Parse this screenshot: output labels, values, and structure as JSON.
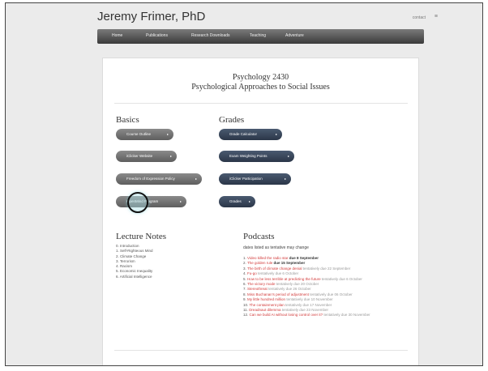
{
  "site": {
    "title": "Jeremy Frimer, PhD",
    "contact": "contact",
    "menu_icon": "hamburger-icon"
  },
  "nav": {
    "items": [
      "Home",
      "Publications",
      "Research Downloads",
      "Teaching",
      "Adventure"
    ]
  },
  "course": {
    "number": "Psychology 2430",
    "name": "Psychological Approaches to Social Issues"
  },
  "basics": {
    "heading": "Basics",
    "buttons": [
      "Course Outline",
      "iClicker Website",
      "Freedom of Expression Policy",
      "OpenMind Program"
    ]
  },
  "grades": {
    "heading": "Grades",
    "buttons": [
      "Grade Calculator",
      "Exam Weighting Points",
      "iClicker Participation",
      "Grades"
    ]
  },
  "lecture_notes": {
    "heading": "Lecture Notes",
    "items": [
      "0. Introduction",
      "1. Self-Righteous Mind",
      "2. Climate Change",
      "3. Terrorism",
      "4. Racism",
      "5. Economic Inequality",
      "6. Artificial Intelligence"
    ]
  },
  "podcasts": {
    "heading": "Podcasts",
    "subtitle": "dates listed as tentative may change",
    "items": [
      {
        "num": "1.",
        "title": "Video killed the radio star",
        "due": "due 8 September",
        "tentative": false
      },
      {
        "num": "2.",
        "title": "The golden rule",
        "due": "due 15 September",
        "tentative": false
      },
      {
        "num": "3.",
        "title": "The birth of climate change denial",
        "due": "tentatively due 22 September",
        "tentative": true
      },
      {
        "num": "4.",
        "title": "Fu-go",
        "due": "tentatively due 6 October",
        "tentative": true
      },
      {
        "num": "5.",
        "title": "How to be less terrible at predicting the future",
        "due": "tentatively due 6 October",
        "tentative": true
      },
      {
        "num": "6.",
        "title": "The victory mode",
        "due": "tentatively due 20 October",
        "tentative": true
      },
      {
        "num": "7.",
        "title": "Stereothreat",
        "due": "tentatively due 26 October",
        "tentative": true
      },
      {
        "num": "8.",
        "title": "Miss Buchanan's period of adjustment",
        "due": "tentatively due 06 October",
        "tentative": true
      },
      {
        "num": "9.",
        "title": "My little hundred million",
        "due": "tentatively due 10 November",
        "tentative": true
      },
      {
        "num": "10.",
        "title": "The containment plan",
        "due": "tentatively due 17 November",
        "tentative": true
      },
      {
        "num": "11.",
        "title": "Dreadnaut dilemma",
        "due": "tentatively due 23 November",
        "tentative": true
      },
      {
        "num": "12.",
        "title": "Can we build AI without losing control over it?",
        "due": "tentatively due 30 November",
        "tentative": true
      }
    ]
  }
}
